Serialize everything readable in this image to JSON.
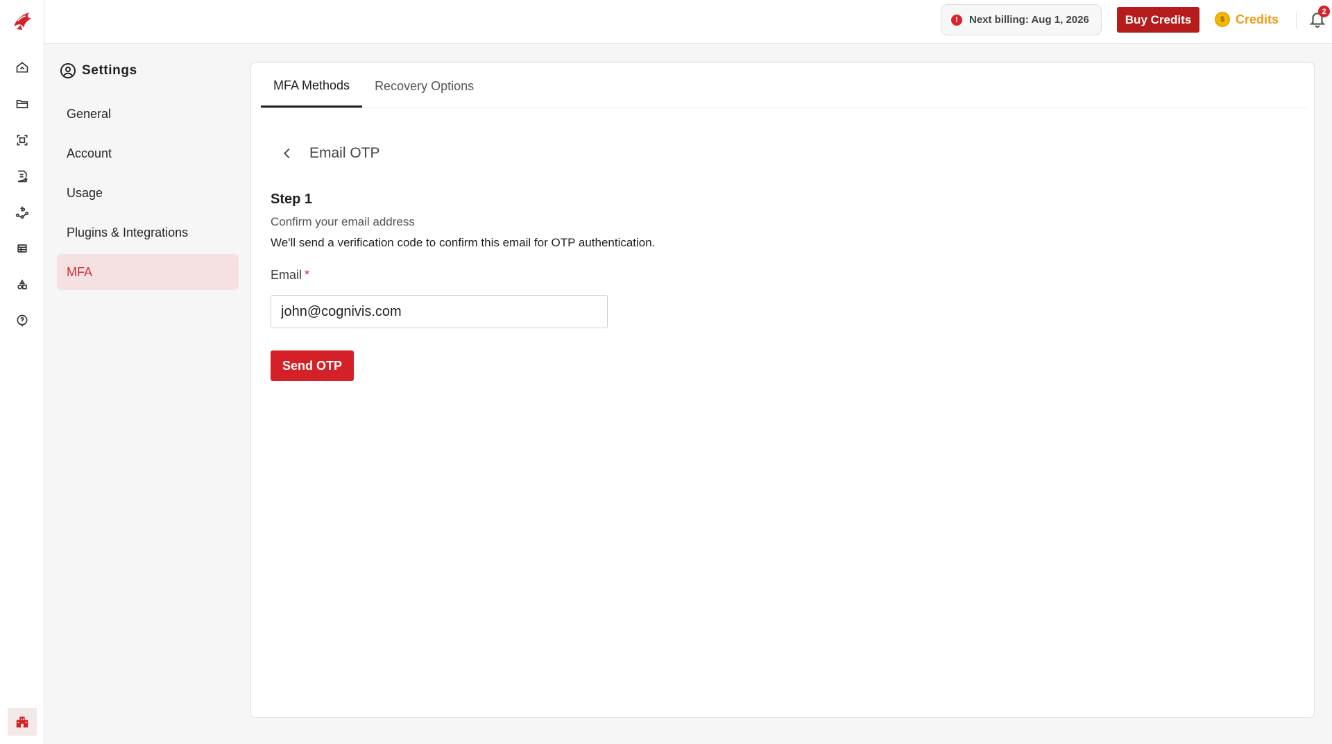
{
  "topbar": {
    "billing_text": "Next billing: Aug 1, 2026",
    "buy_credits_label": "Buy Credits",
    "credits_label": "Credits",
    "notification_count": "2",
    "icons": [
      "info-icon",
      "coin-icon",
      "bell-icon",
      "help-icon"
    ]
  },
  "rail": {
    "icons": [
      "app-logo-icon",
      "home-icon",
      "folder-icon",
      "scan-icon",
      "document-add-icon",
      "billing-icon",
      "table-icon",
      "shapes-icon",
      "help-icon",
      "organization-icon"
    ]
  },
  "settings": {
    "title": "Settings",
    "menu": [
      {
        "label": "General"
      },
      {
        "label": "Account"
      },
      {
        "label": "Usage"
      },
      {
        "label": "Plugins & Integrations"
      },
      {
        "label": "MFA"
      }
    ],
    "active_item": "MFA"
  },
  "tabs": [
    {
      "label": "MFA Methods"
    },
    {
      "label": "Recovery Options"
    }
  ],
  "active_tab": "MFA Methods",
  "form": {
    "heading": "Email OTP",
    "step_title": "Step 1",
    "step_subtitle": "Confirm your email address",
    "step_description": "We'll send a verification code to confirm this email for OTP authentication.",
    "email_label": "Email",
    "required_mark": "*",
    "email_value": "john@cognivis.com",
    "send_button_label": "Send OTP"
  },
  "colors": {
    "accent": "#d42027",
    "buy_credits_bg": "#b71c1c",
    "credits_text": "#f09a16",
    "active_menu_bg": "#f5e0e2",
    "active_menu_text": "#d1313b"
  }
}
